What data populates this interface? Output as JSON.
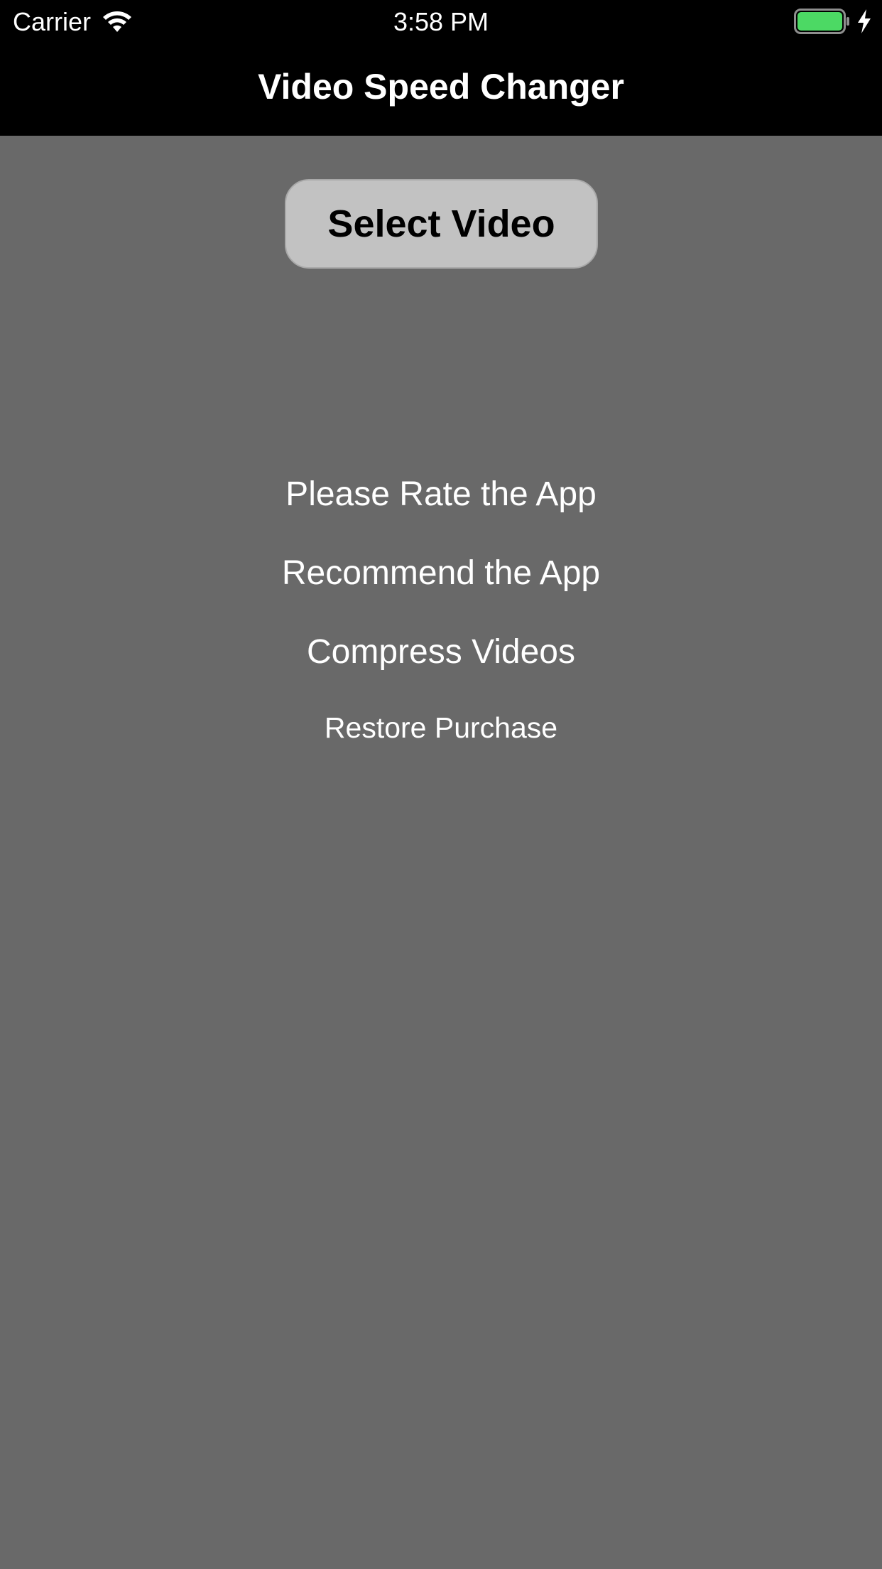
{
  "status_bar": {
    "carrier": "Carrier",
    "time": "3:58 PM",
    "wifi_icon": "wifi-icon",
    "battery_icon": "battery-full-icon",
    "charging_icon": "charging-bolt-icon",
    "battery_color": "#4cd964"
  },
  "nav": {
    "title": "Video Speed Changer"
  },
  "main": {
    "select_video_label": "Select Video",
    "links": {
      "rate": "Please Rate the App",
      "recommend": "Recommend the App",
      "compress": "Compress Videos",
      "restore": "Restore Purchase"
    }
  },
  "colors": {
    "background": "#696969",
    "topbar": "#000000",
    "button_fill": "#c2c2c2",
    "text_light": "#ffffff"
  }
}
